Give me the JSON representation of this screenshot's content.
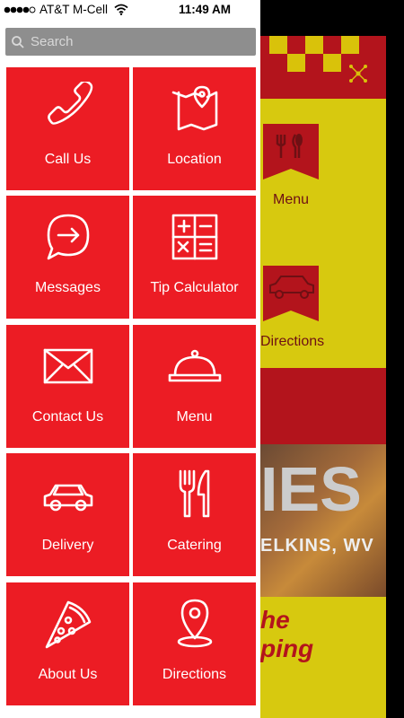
{
  "status_bar": {
    "carrier": "AT&T M-Cell",
    "time": "11:49 AM"
  },
  "search": {
    "placeholder": "Search"
  },
  "tiles": [
    {
      "label": "Call Us",
      "icon": "phone-icon"
    },
    {
      "label": "Location",
      "icon": "map-icon"
    },
    {
      "label": "Messages",
      "icon": "message-icon"
    },
    {
      "label": "Tip Calculator",
      "icon": "calculator-icon"
    },
    {
      "label": "Contact Us",
      "icon": "envelope-icon"
    },
    {
      "label": "Menu",
      "icon": "cloche-icon"
    },
    {
      "label": "Delivery",
      "icon": "car-icon"
    },
    {
      "label": "Catering",
      "icon": "fork-knife-icon"
    },
    {
      "label": "About Us",
      "icon": "pizza-slice-icon"
    },
    {
      "label": "Directions",
      "icon": "location-pin-icon"
    }
  ],
  "background": {
    "menu_label": "Menu",
    "directions_label": "Directions",
    "banner_text": "IES",
    "city_text": "ELKINS, WV",
    "script_line1": "he",
    "script_line2": "ping"
  },
  "colors": {
    "tile": "#ec1c24",
    "drawer": "#ffffff",
    "search_bar": "#8e8e8e"
  }
}
